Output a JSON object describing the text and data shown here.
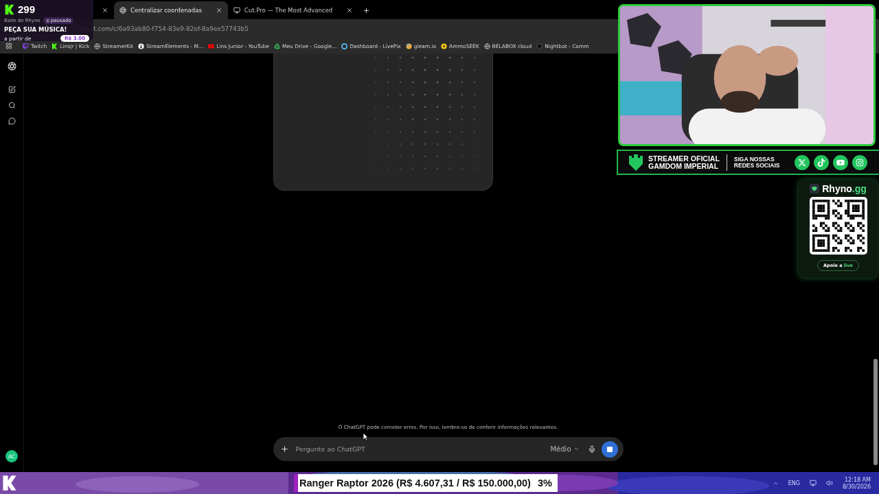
{
  "song_widget": {
    "count": "299",
    "song": "Baile do Rhyno",
    "status": "pausado",
    "title": "PEÇA SUA MÚSICA!",
    "price_label": "a partir de",
    "price": "R$ 3.00"
  },
  "tabs": [
    {
      "selected": false
    },
    {
      "title": "Centralizar coordenadas",
      "selected": true
    },
    {
      "title": "Cut.Pro — The Most Advanced",
      "selected": false
    }
  ],
  "address": {
    "url": "chatgpt.com/c/6a93ab80-f754-83e9-82ef-8a9ee57743b5"
  },
  "bookmarks": [
    {
      "label": "Twitch",
      "kind": "twitch"
    },
    {
      "label": "Linsjr | Kick",
      "kind": "kick"
    },
    {
      "label": "StreamerKit",
      "kind": "globe"
    },
    {
      "label": "StreamElements - M...",
      "kind": "streamelements"
    },
    {
      "label": "Lins Junior - YouTube",
      "kind": "youtube"
    },
    {
      "label": "Meu Drive - Google...",
      "kind": "drive"
    },
    {
      "label": "Dashboard - LivePix",
      "kind": "livepix"
    },
    {
      "label": "gleam.io",
      "kind": "gleam"
    },
    {
      "label": "AmmoSEEK",
      "kind": "ammoseek"
    },
    {
      "label": "BELABOX cloud",
      "kind": "globe"
    },
    {
      "label": "Nightbot - Comm",
      "kind": "nightbot"
    }
  ],
  "chat": {
    "disclaimer": "O ChatGPT pode cometer erros. Por isso, lembre-se de conferir informações relevantes.",
    "placeholder": "Pergunte ao ChatGPT",
    "model": "Médio",
    "avatar": "AC"
  },
  "banner": {
    "line1": "STREAMER OFICIAL",
    "line2": "GAMDOM IMPERIAL",
    "social1": "SIGA NOSSAS",
    "social2": "REDES SOCIAIS",
    "networks": [
      {
        "kind": "x"
      },
      {
        "kind": "tiktok"
      },
      {
        "kind": "youtube"
      },
      {
        "kind": "instagram"
      }
    ]
  },
  "support_card": {
    "brand": "Rhyno",
    "brand_suffix": ".gg",
    "button": "Apoie a",
    "button_accent": "live"
  },
  "ticker": {
    "text": "Ranger Raptor 2026 (R$ 4.607,31 / R$ 150.000,00)",
    "percent": "3%"
  },
  "tray": {
    "language": "ENG",
    "time": "12:18 AM",
    "date": "8/30/2026"
  }
}
